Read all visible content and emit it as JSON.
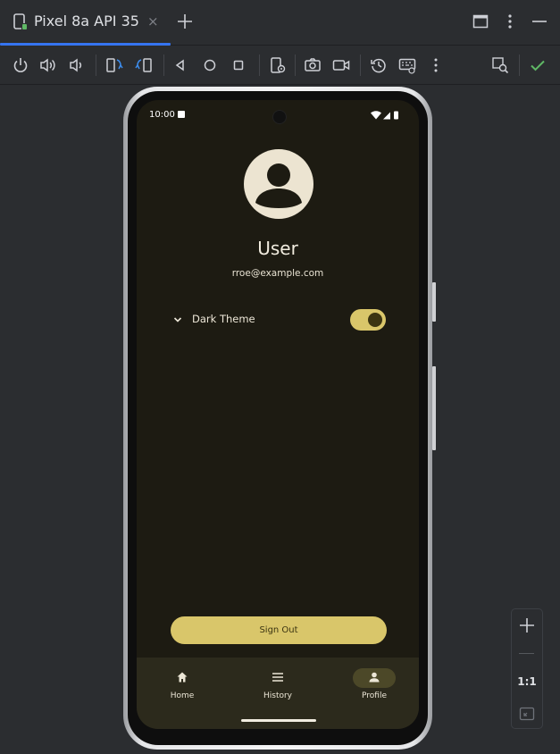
{
  "ide": {
    "tab": {
      "title": "Pixel 8a API 35",
      "close": "×"
    },
    "toolbar": {
      "buttons": [
        "power-icon",
        "volume-up-icon",
        "volume-down-icon",
        "rotate-left-icon",
        "rotate-right-icon",
        "back-icon",
        "home-icon",
        "overview-icon",
        "device-settings-icon",
        "screenshot-icon",
        "screen-record-icon",
        "snapshot-icon",
        "keyboard-icon",
        "more-icon",
        "inspect-icon",
        "check-icon"
      ]
    },
    "zoom": {
      "reset_label": "1:1"
    },
    "colors": {
      "accent": "#3574f0",
      "check": "#5fb865"
    }
  },
  "device": {
    "status_bar": {
      "time": "10:00"
    },
    "profile": {
      "name": "User",
      "email": "rroe@example.com",
      "dark_theme_label": "Dark Theme",
      "dark_theme_enabled": true
    },
    "sign_out_label": "Sign Out",
    "bottom_nav": [
      {
        "label": "Home",
        "icon": "home-icon",
        "active": false
      },
      {
        "label": "History",
        "icon": "history-icon",
        "active": false
      },
      {
        "label": "Profile",
        "icon": "person-icon",
        "active": true
      }
    ],
    "colors": {
      "background": "#1d1b12",
      "accent": "#d9c66a",
      "nav_background": "#2c2a1c"
    }
  }
}
